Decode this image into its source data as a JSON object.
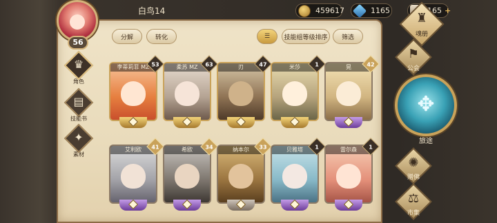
{
  "header": {
    "username": "白鸟14",
    "level": "56",
    "gold": "459617",
    "crystal": "1165",
    "ticket": "165",
    "ticket_plus": "+"
  },
  "side_tabs": [
    {
      "label": "角色",
      "icon": "character-icon"
    },
    {
      "label": "技能书",
      "icon": "skillbook-icon"
    },
    {
      "label": "素材",
      "icon": "material-icon"
    }
  ],
  "filters": {
    "decompose": "分解",
    "convert": "转化",
    "sort_icon": "sort-list-icon",
    "sort": "技能组等级排序",
    "filter": "筛选"
  },
  "cards_row1": [
    {
      "name": "李蒂莉菲 MZ",
      "badge": "53",
      "tier": "gold"
    },
    {
      "name": "柔苏 MZ",
      "badge": "63",
      "tier": "gold"
    },
    {
      "name": "刃",
      "badge": "47",
      "tier": "gold"
    },
    {
      "name": "米莎",
      "badge": "1",
      "tier": "gold"
    },
    {
      "name": "晃",
      "badge": "42",
      "tier": "purple"
    }
  ],
  "cards_row2": [
    {
      "name": "艾利欧",
      "badge": "41",
      "tier": "purple"
    },
    {
      "name": "希欧",
      "badge": "34",
      "tier": "purple"
    },
    {
      "name": "纳本尔",
      "badge": "33",
      "tier": "gray"
    },
    {
      "name": "贝雅塔",
      "badge": "1",
      "tier": "purple"
    },
    {
      "name": "雷尔森",
      "badge": "1",
      "tier": "purple"
    }
  ],
  "nav": {
    "book": "魂册",
    "guild": "公会",
    "journey": "旅途",
    "summon": "赠佛",
    "market": "市集"
  }
}
